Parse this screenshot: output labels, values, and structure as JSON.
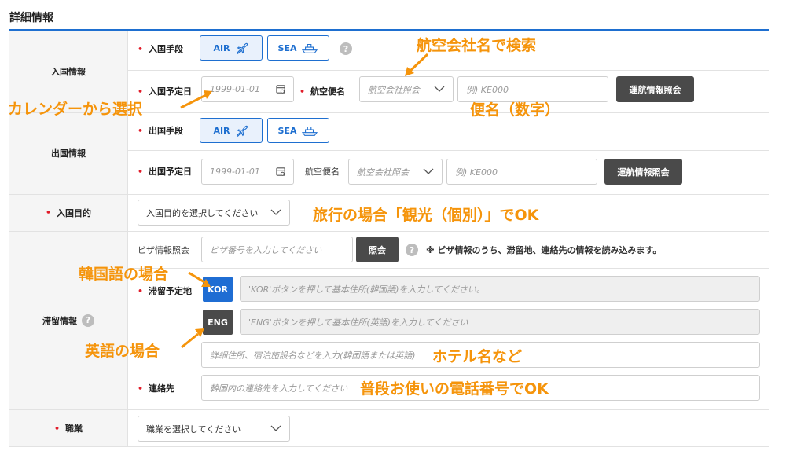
{
  "section_title": "詳細情報",
  "entry": {
    "label": "入国情報",
    "method_label": "入国手段",
    "air_label": "AIR",
    "sea_label": "SEA",
    "date_label": "入国予定日",
    "date_placeholder": "1999-01-01",
    "flight_label": "航空便名",
    "airline_placeholder": "航空会社照会",
    "flight_placeholder": "例) KE000",
    "lookup_button": "運航情報照会"
  },
  "exit": {
    "label": "出国情報",
    "method_label": "出国手段",
    "air_label": "AIR",
    "sea_label": "SEA",
    "date_label": "出国予定日",
    "date_placeholder": "1999-01-01",
    "flight_label": "航空便名",
    "airline_placeholder": "航空会社照会",
    "flight_placeholder": "例) KE000",
    "lookup_button": "運航情報照会"
  },
  "purpose": {
    "label": "入国目的",
    "select_value": "入国目的を選択してください"
  },
  "stay": {
    "label": "滞留情報",
    "visa_label": "ビザ情報照会",
    "visa_placeholder": "ビザ番号を入力してください",
    "visa_button": "照会",
    "visa_note": "※ ビザ情報のうち、滞留地、連絡先の情報を読み込みます。",
    "address_label": "滞留予定地",
    "kor_button": "KOR",
    "eng_button": "ENG",
    "kor_placeholder": "'KOR'ボタンを押して基本住所(韓国語)を入力してください。",
    "eng_placeholder": "'ENG'ボタンを押して基本住所(英語)を入力してください",
    "detail_placeholder": "詳細住所、宿泊施設名などを入力(韓国語または英語)",
    "contact_label": "連絡先",
    "contact_placeholder": "韓国内の連絡先を入力してください"
  },
  "job": {
    "label": "職業",
    "select_value": "職業を選択してください"
  },
  "help_glyph": "?",
  "annotations": {
    "airline_search": "航空会社名で検索",
    "calendar_select": "カレンダーから選択",
    "flight_number": "便名（数字）",
    "purpose_tip": "旅行の場合「観光（個別）」でOK",
    "korean_case": "韓国語の場合",
    "english_case": "英語の場合",
    "hotel_name": "ホテル名など",
    "phone_tip": "普段お使いの電話番号でOK"
  },
  "colors": {
    "accent": "#1e6fd0",
    "annotation": "#f5940b",
    "required": "#e11d2a",
    "dark_button": "#4a4a4a"
  }
}
